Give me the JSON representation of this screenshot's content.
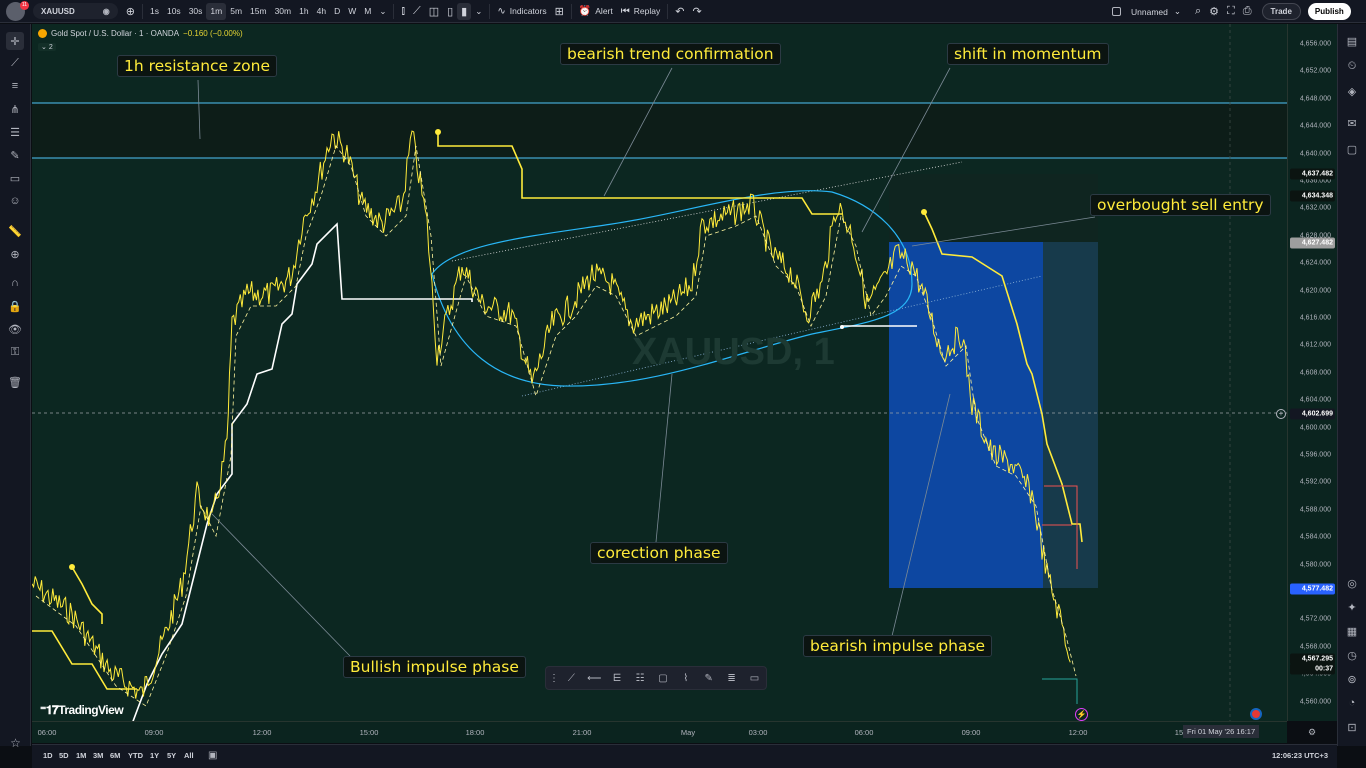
{
  "topbar": {
    "notification_count": "11",
    "symbol": "XAUUSD",
    "intervals": [
      "1s",
      "10s",
      "30s",
      "1m",
      "5m",
      "15m",
      "30m",
      "1h",
      "4h",
      "D",
      "W",
      "M"
    ],
    "active_interval": "1m",
    "indicators_label": "Indicators",
    "alert_label": "Alert",
    "replay_label": "Replay",
    "layout_name": "Unnamed",
    "trade_label": "Trade",
    "publish_label": "Publish"
  },
  "legend": {
    "title": "Gold Spot / U.S. Dollar · 1 · OANDA",
    "change": "−0.160 (−0.00%)",
    "indicator_count": "2"
  },
  "price_axis": {
    "ticks": [
      "4,656.000",
      "4,652.000",
      "4,648.000",
      "4,644.000",
      "4,640.000",
      "4,636.000",
      "4,632.000",
      "4,628.000",
      "4,624.000",
      "4,620.000",
      "4,616.000",
      "4,612.000",
      "4,608.000",
      "4,604.000",
      "4,600.000",
      "4,596.000",
      "4,592.000",
      "4,588.000",
      "4,584.000",
      "4,580.000",
      "4,576.000",
      "4,572.000",
      "4,568.000",
      "4,564.000",
      "4,560.000"
    ],
    "labels": {
      "high": "4,637.482",
      "mid": "4,634.348",
      "entry": "4,627.482",
      "crosshair": "4,602.699",
      "target": "4,577.482",
      "last": "4,567.295",
      "countdown": "00:37"
    }
  },
  "time_axis": {
    "ticks": [
      "06:00",
      "09:00",
      "12:00",
      "15:00",
      "18:00",
      "21:00",
      "May",
      "03:00",
      "06:00",
      "09:00",
      "12:00",
      "15:"
    ],
    "crosshair_label": "Fri 01 May '26   16:17"
  },
  "annotations": {
    "resistance": "1h resistance zone",
    "bearish_trend": "bearish trend confirmation",
    "momentum": "shift in momentum",
    "overbought": "overbought sell entry",
    "correction": "corection phase",
    "bullish": "Bullish impulse phase",
    "bearish_impulse": "bearish impulse phase"
  },
  "watermark": "XAUUSD, 1",
  "brand": "TradingView",
  "bottombar": {
    "ranges": [
      "1D",
      "5D",
      "1M",
      "3M",
      "6M",
      "YTD",
      "1Y",
      "5Y",
      "All"
    ],
    "clock": "12:06:23 UTC+3"
  },
  "colors": {
    "chart_bg": "#0c2721",
    "price_line": "#ffeb3b",
    "trail_white": "#ffffff",
    "resistance_line": "#4fc3f7",
    "short_zone": "#0d47a1",
    "stop_zone": "#1b3d36"
  }
}
